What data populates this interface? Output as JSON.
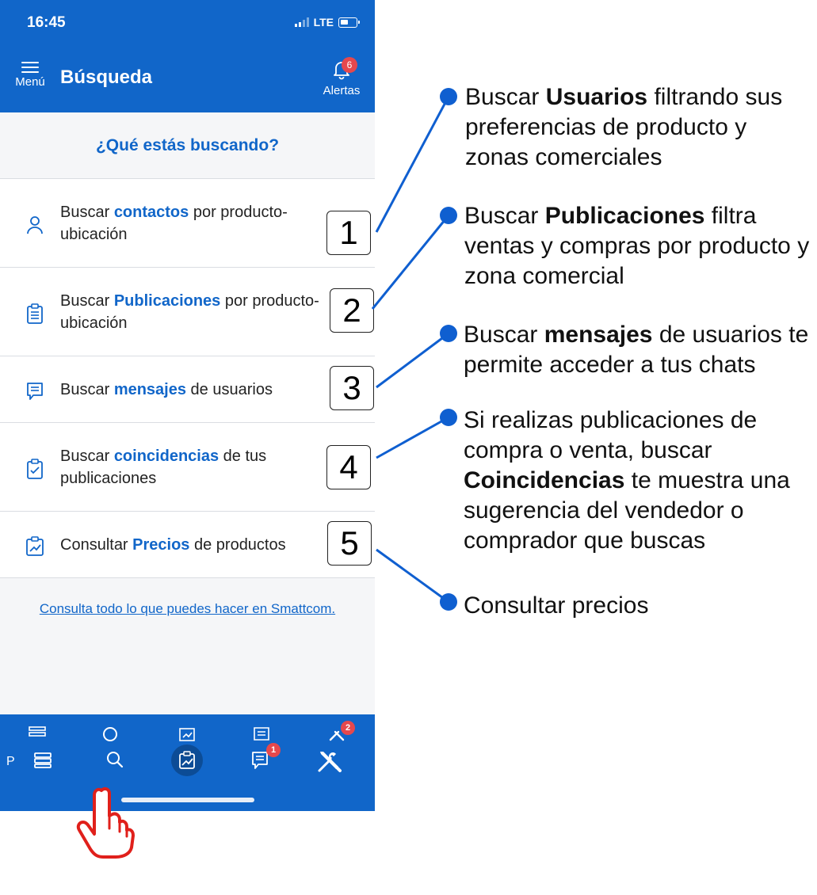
{
  "status": {
    "time": "16:45",
    "network": "LTE"
  },
  "header": {
    "menu_label": "Menú",
    "title": "Búsqueda",
    "alerts_label": "Alertas",
    "alerts_badge": "6"
  },
  "search": {
    "question": "¿Qué estás buscando?",
    "options": [
      {
        "pre": "Buscar ",
        "bold": "contactos",
        "post": " por producto-ubicación",
        "icon": "user-icon",
        "number": "1"
      },
      {
        "pre": "Buscar ",
        "bold": "Publicaciones",
        "post": " por producto-ubicación",
        "icon": "clipboard-list-icon",
        "number": "2"
      },
      {
        "pre": "Buscar ",
        "bold": "mensajes",
        "post": " de usuarios",
        "icon": "message-icon",
        "number": "3"
      },
      {
        "pre": "Buscar ",
        "bold": "coincidencias",
        "post": " de tus publicaciones",
        "icon": "clipboard-check-icon",
        "number": "4"
      },
      {
        "pre": "Consultar ",
        "bold": "Precios",
        "post": " de productos",
        "icon": "price-chart-icon",
        "number": "5"
      }
    ],
    "footer_link": "Consulta todo lo que puedes hacer en Smattcom."
  },
  "tabbar": {
    "left_letter": "P",
    "ghost_badge": "2",
    "tabs": [
      {
        "icon": "stack-icon"
      },
      {
        "icon": "search-icon"
      },
      {
        "icon": "price-chart-icon",
        "active": true
      },
      {
        "icon": "message-icon",
        "badge": "1"
      },
      {
        "icon": "tools-icon"
      }
    ]
  },
  "annotations": [
    {
      "pre": "Buscar ",
      "bold": "Usuarios",
      "post": " filtrando sus preferencias de producto y zonas comerciales"
    },
    {
      "pre": "Buscar ",
      "bold": "Publicaciones",
      "post": "  filtra ventas y compras por producto y zona comercial"
    },
    {
      "pre": "Buscar ",
      "bold": "mensajes",
      "post": " de usuarios te permite acceder a tus chats"
    },
    {
      "pre": "Si realizas publicaciones de compra o venta, buscar ",
      "bold": "Coincidencias",
      "post": " te muestra una sugerencia del vendedor o comprador que buscas"
    },
    {
      "pre": "Consultar precios",
      "bold": "",
      "post": ""
    }
  ],
  "colors": {
    "brand_blue": "#1166c9",
    "badge_red": "#e5484d",
    "callout_blue": "#0f5fd0",
    "hand_red": "#e0201b"
  }
}
